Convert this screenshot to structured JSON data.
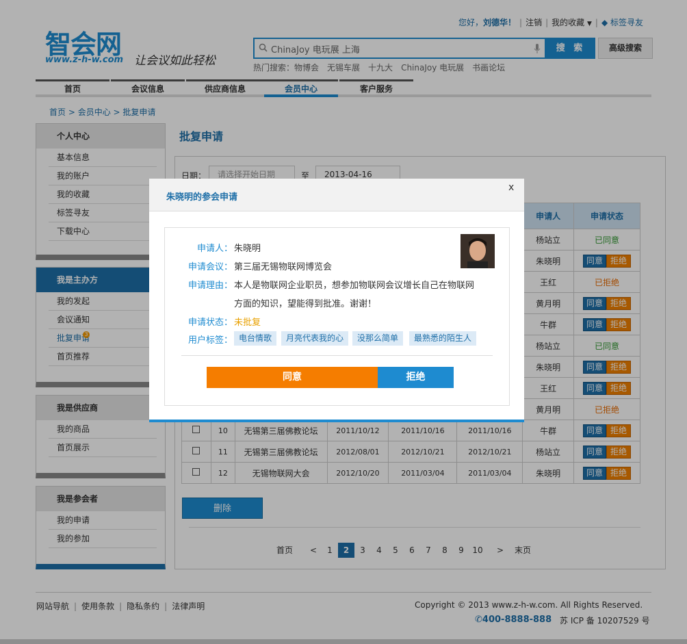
{
  "header": {
    "logo_text": "智会网",
    "logo_url": "www.z-h-w.com",
    "slogan": "让会议如此轻松",
    "greeting": "您好，",
    "username": "刘德华！",
    "logout": "注销",
    "favorites": "我的收藏",
    "tag_friends": "标签寻友",
    "search_value": "ChinaJoy 电玩展 上海",
    "search_button": "搜 索",
    "advanced_search": "高级搜索",
    "hot_label": "热门搜索：",
    "hot_terms": [
      "物博会",
      "无锡车展",
      "十九大",
      "ChinaJoy 电玩展",
      "书画论坛"
    ]
  },
  "nav": {
    "items": [
      "首页",
      "会议信息",
      "供应商信息",
      "会员中心",
      "客户服务"
    ],
    "active": "会员中心"
  },
  "breadcrumb": [
    "首页",
    "会员中心",
    "批复申请"
  ],
  "sidebar": {
    "blocks": [
      {
        "title": "个人中心",
        "items": [
          "基本信息",
          "我的账户",
          "我的收藏",
          "标签寻友",
          "下载中心"
        ]
      },
      {
        "title": "我是主办方",
        "items": [
          "我的发起",
          "会议通知",
          "批复申请",
          "首页推荐"
        ],
        "badge": "3"
      },
      {
        "title": "我是供应商",
        "items": [
          "我的商品",
          "首页展示"
        ]
      },
      {
        "title": "我是参会者",
        "items": [
          "我的申请",
          "我的参加"
        ]
      }
    ]
  },
  "main": {
    "title": "批复申请",
    "filter": {
      "date_label": "日期：",
      "start_placeholder": "请选择开始日期",
      "to_label": "至",
      "end_value": "2013-04-16"
    },
    "table": {
      "headers": [
        "申请人",
        "申请状态"
      ],
      "status_only_rows": [
        {
          "applicant": "杨站立",
          "status": "已同意"
        },
        {
          "applicant": "朱晓明",
          "status": "pending"
        },
        {
          "applicant": "王红",
          "status": "已拒绝"
        },
        {
          "applicant": "黄月明",
          "status": "pending"
        },
        {
          "applicant": "牛群",
          "status": "pending"
        },
        {
          "applicant": "杨站立",
          "status": "已同意"
        },
        {
          "applicant": "朱晓明",
          "status": "pending"
        },
        {
          "applicant": "王红",
          "status": "pending"
        },
        {
          "applicant": "黄月明",
          "status": "已拒绝"
        }
      ],
      "full_rows": [
        {
          "no": "10",
          "name": "无锡第三届佛教论坛",
          "d1": "2011/10/12",
          "d2": "2011/10/16",
          "d3": "2011/10/16",
          "applicant": "牛群"
        },
        {
          "no": "11",
          "name": "无锡第三届佛教论坛",
          "d1": "2012/08/01",
          "d2": "2012/10/21",
          "d3": "2012/10/21",
          "applicant": "杨站立"
        },
        {
          "no": "12",
          "name": "无锡物联网大会",
          "d1": "2012/10/20",
          "d2": "2011/03/04",
          "d3": "2011/03/04",
          "applicant": "朱晓明"
        }
      ],
      "agree_label": "同意",
      "reject_label": "拒绝"
    },
    "delete_button": "删除",
    "pager": {
      "first": "首页",
      "prev": "<",
      "pages": [
        "1",
        "2",
        "3",
        "4",
        "5",
        "6",
        "7",
        "8",
        "9",
        "10"
      ],
      "current": "2",
      "next": ">",
      "last": "末页"
    }
  },
  "modal": {
    "title": "朱晓明的参会申请",
    "close": "x",
    "applicant_label": "申请人：",
    "applicant": "朱晓明",
    "meeting_label": "申请会议：",
    "meeting": "第三届无锡物联网博览会",
    "reason_label": "申请理由：",
    "reason_line1": "本人是物联网企业职员，想参加物联网会议增长自己在物联网",
    "reason_line2": "方面的知识，望能得到批准。谢谢！",
    "status_label": "申请状态：",
    "status": "未批复",
    "tags_label": "用户标签：",
    "tags": [
      "电台情歌",
      "月亮代表我的心",
      "没那么简单",
      "最熟悉的陌生人"
    ],
    "agree": "同意",
    "reject": "拒绝"
  },
  "footer": {
    "links": [
      "网站导航",
      "使用条款",
      "隐私条约",
      "法律声明"
    ],
    "copyright": "Copyright © 2013 www.z-h-w.com. All Rights Reserved.",
    "phone": "400-8888-888",
    "icp": "苏 ICP 备 10207529 号"
  },
  "colors": {
    "brand_blue": "#1e8bd0",
    "accent_orange": "#f57d00",
    "agreed_green": "#339933",
    "rejected_orange": "#e86a00"
  }
}
